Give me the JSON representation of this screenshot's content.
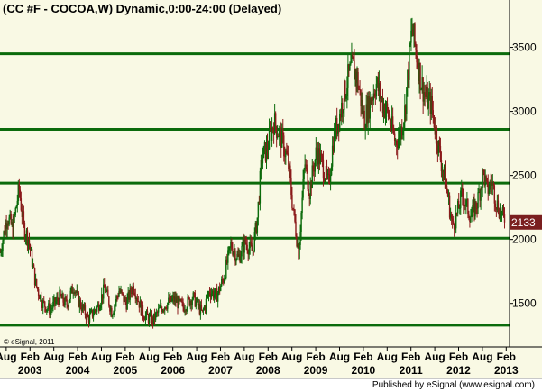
{
  "chart_data": {
    "type": "candlestick",
    "title": "(CC #F - COCOA,W) Dynamic,0:00-24:00 (Delayed)",
    "xlabel": "",
    "ylabel": "",
    "x_range": [
      2002.45,
      2013.15
    ],
    "ylim": [
      1160,
      3870
    ],
    "y_ticks": [
      1500,
      2000,
      2500,
      3000,
      3500
    ],
    "y_tick_labels": [
      "1500",
      "2000",
      "2500",
      "3000",
      "3500"
    ],
    "x_ticks": [
      {
        "t": 2002.58,
        "label": "Aug"
      },
      {
        "t": 2003.08,
        "label": "Feb",
        "year": "2003"
      },
      {
        "t": 2003.58,
        "label": "Aug"
      },
      {
        "t": 2004.08,
        "label": "Feb",
        "year": "2004"
      },
      {
        "t": 2004.58,
        "label": "Aug"
      },
      {
        "t": 2005.08,
        "label": "Feb",
        "year": "2005"
      },
      {
        "t": 2005.58,
        "label": "Aug"
      },
      {
        "t": 2006.08,
        "label": "Feb",
        "year": "2006"
      },
      {
        "t": 2006.58,
        "label": "Aug"
      },
      {
        "t": 2007.08,
        "label": "Feb",
        "year": "2007"
      },
      {
        "t": 2007.58,
        "label": "Aug"
      },
      {
        "t": 2008.08,
        "label": "Feb",
        "year": "2008"
      },
      {
        "t": 2008.58,
        "label": "Aug"
      },
      {
        "t": 2009.08,
        "label": "Feb",
        "year": "2009"
      },
      {
        "t": 2009.58,
        "label": "Aug"
      },
      {
        "t": 2010.08,
        "label": "Feb",
        "year": "2010"
      },
      {
        "t": 2010.58,
        "label": "Aug"
      },
      {
        "t": 2011.08,
        "label": "Feb",
        "year": "2011"
      },
      {
        "t": 2011.58,
        "label": "Aug"
      },
      {
        "t": 2012.08,
        "label": "Feb",
        "year": "2012"
      },
      {
        "t": 2012.58,
        "label": "Aug"
      },
      {
        "t": 2013.08,
        "label": "Feb",
        "year": "2013"
      }
    ],
    "horizontal_levels": [
      1330,
      2010,
      2440,
      2860,
      3450
    ],
    "last_price": 2133,
    "last_price_label": "2133",
    "series": [
      {
        "values": [
          [
            2002.45,
            1900
          ],
          [
            2002.6,
            2180
          ],
          [
            2002.72,
            2080
          ],
          [
            2002.85,
            2400
          ],
          [
            2002.95,
            2090
          ],
          [
            2003.05,
            2000
          ],
          [
            2003.2,
            1650
          ],
          [
            2003.35,
            1500
          ],
          [
            2003.5,
            1450
          ],
          [
            2003.7,
            1550
          ],
          [
            2003.85,
            1490
          ],
          [
            2004.0,
            1640
          ],
          [
            2004.1,
            1520
          ],
          [
            2004.3,
            1380
          ],
          [
            2004.5,
            1470
          ],
          [
            2004.65,
            1620
          ],
          [
            2004.8,
            1430
          ],
          [
            2004.95,
            1600
          ],
          [
            2005.1,
            1500
          ],
          [
            2005.25,
            1640
          ],
          [
            2005.45,
            1420
          ],
          [
            2005.65,
            1360
          ],
          [
            2005.8,
            1450
          ],
          [
            2005.95,
            1500
          ],
          [
            2006.1,
            1530
          ],
          [
            2006.3,
            1470
          ],
          [
            2006.5,
            1550
          ],
          [
            2006.7,
            1420
          ],
          [
            2006.85,
            1600
          ],
          [
            2007.0,
            1560
          ],
          [
            2007.15,
            1700
          ],
          [
            2007.3,
            1960
          ],
          [
            2007.45,
            1850
          ],
          [
            2007.6,
            1980
          ],
          [
            2007.75,
            1900
          ],
          [
            2007.85,
            2150
          ],
          [
            2007.95,
            2640
          ],
          [
            2008.05,
            2700
          ],
          [
            2008.2,
            2920
          ],
          [
            2008.35,
            2800
          ],
          [
            2008.5,
            2600
          ],
          [
            2008.6,
            2250
          ],
          [
            2008.72,
            1900
          ],
          [
            2008.85,
            2600
          ],
          [
            2008.95,
            2380
          ],
          [
            2009.1,
            2700
          ],
          [
            2009.25,
            2550
          ],
          [
            2009.35,
            2420
          ],
          [
            2009.45,
            2780
          ],
          [
            2009.6,
            3000
          ],
          [
            2009.75,
            3250
          ],
          [
            2009.85,
            3350
          ],
          [
            2009.95,
            3260
          ],
          [
            2010.1,
            2930
          ],
          [
            2010.2,
            3050
          ],
          [
            2010.35,
            3220
          ],
          [
            2010.5,
            3050
          ],
          [
            2010.6,
            2980
          ],
          [
            2010.75,
            2760
          ],
          [
            2010.85,
            2820
          ],
          [
            2010.95,
            3000
          ],
          [
            2011.1,
            3650
          ],
          [
            2011.18,
            3480
          ],
          [
            2011.3,
            3220
          ],
          [
            2011.4,
            3100
          ],
          [
            2011.5,
            3060
          ],
          [
            2011.6,
            2850
          ],
          [
            2011.72,
            2600
          ],
          [
            2011.85,
            2350
          ],
          [
            2011.95,
            2100
          ],
          [
            2012.05,
            2200
          ],
          [
            2012.15,
            2350
          ],
          [
            2012.25,
            2250
          ],
          [
            2012.35,
            2180
          ],
          [
            2012.48,
            2300
          ],
          [
            2012.6,
            2520
          ],
          [
            2012.68,
            2380
          ],
          [
            2012.78,
            2450
          ],
          [
            2012.88,
            2280
          ],
          [
            2012.98,
            2200
          ],
          [
            2013.06,
            2133
          ]
        ]
      }
    ],
    "colors": {
      "up": "#0b6b0b",
      "down": "#8b1a1a",
      "level_line": "#0b6b0b",
      "background": "#f9f9e4",
      "price_tag": "#7a1f1f"
    },
    "watermark": "© eSignal, 2011",
    "grid": false
  },
  "footer": {
    "text": "Published by eSignal (www.esignal.com)"
  }
}
